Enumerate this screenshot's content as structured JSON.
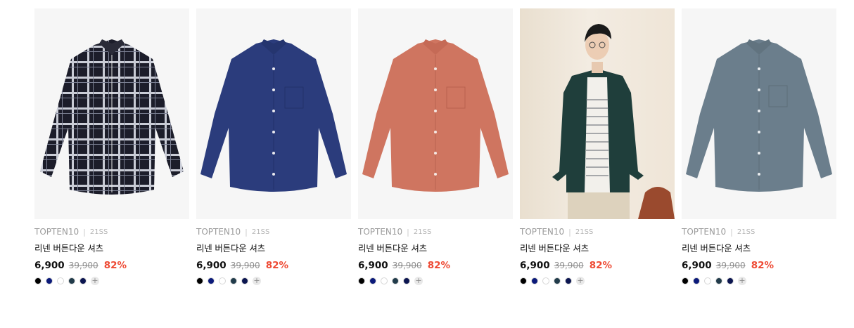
{
  "products": [
    {
      "brand": "TOPTEN10",
      "season": "21SS",
      "name": "리넨 버튼다운 셔츠",
      "price": "6,900",
      "original_price": "39,900",
      "discount": "82%",
      "image": "plaid-shirt",
      "swatches": [
        "#000000",
        "#0b1a7a",
        "#ffffff",
        "#213b4a",
        "#0b1550"
      ],
      "more_icon": "plus-icon"
    },
    {
      "brand": "TOPTEN10",
      "season": "21SS",
      "name": "리넨 버튼다운 셔츠",
      "price": "6,900",
      "original_price": "39,900",
      "discount": "82%",
      "image": "navy-shirt",
      "swatches": [
        "#000000",
        "#0b1a7a",
        "#ffffff",
        "#213b4a",
        "#0b1550"
      ],
      "more_icon": "plus-icon"
    },
    {
      "brand": "TOPTEN10",
      "season": "21SS",
      "name": "리넨 버튼다운 셔츠",
      "price": "6,900",
      "original_price": "39,900",
      "discount": "82%",
      "image": "coral-shirt",
      "swatches": [
        "#000000",
        "#0b1a7a",
        "#ffffff",
        "#213b4a",
        "#0b1550"
      ],
      "more_icon": "plus-icon"
    },
    {
      "brand": "TOPTEN10",
      "season": "21SS",
      "name": "리넨 버튼다운 셔츠",
      "price": "6,900",
      "original_price": "39,900",
      "discount": "82%",
      "image": "model-photo",
      "swatches": [
        "#000000",
        "#0b1a7a",
        "#ffffff",
        "#213b4a",
        "#0b1550"
      ],
      "more_icon": "plus-icon"
    },
    {
      "brand": "TOPTEN10",
      "season": "21SS",
      "name": "리넨 버튼다운 셔츠",
      "price": "6,900",
      "original_price": "39,900",
      "discount": "82%",
      "image": "blue-grey-shirt",
      "swatches": [
        "#000000",
        "#0b1a7a",
        "#ffffff",
        "#213b4a",
        "#0b1550"
      ],
      "more_icon": "plus-icon"
    }
  ],
  "colors": {
    "discount": "#ee4a34",
    "shirt_navy": "#2b3c7c",
    "shirt_coral": "#cf7560",
    "shirt_blue_grey": "#6b7e8c",
    "shirt_plaid": "#1c1d2a"
  }
}
